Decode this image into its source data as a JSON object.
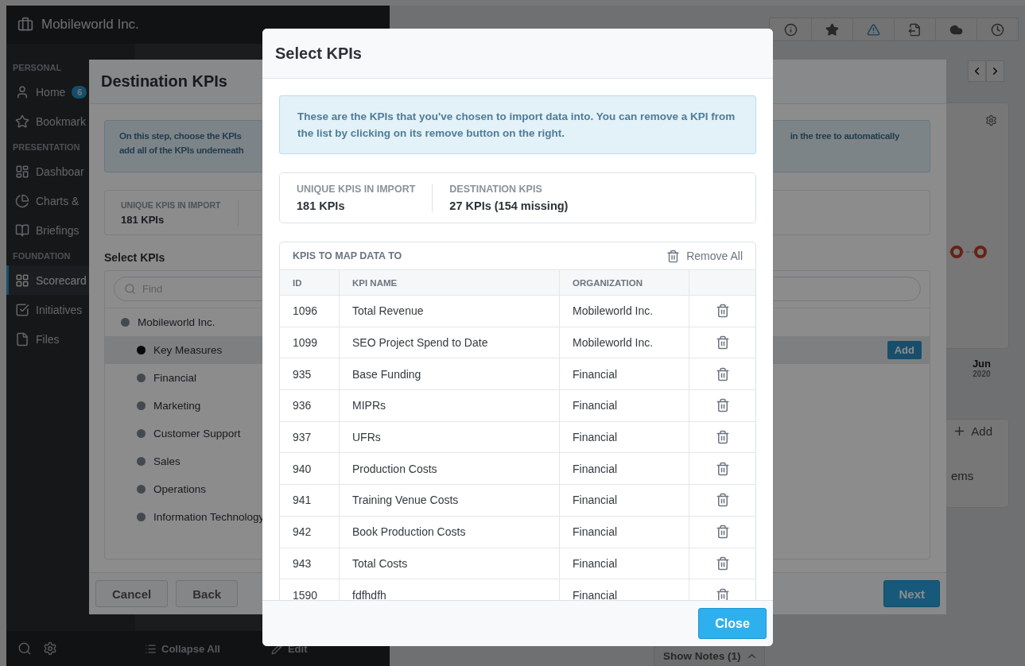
{
  "sidebar": {
    "title": "Mobileworld Inc.",
    "sections": [
      {
        "label": "PERSONAL",
        "items": [
          {
            "label": "Home",
            "badge": "6",
            "selected": false
          },
          {
            "label": "Bookmark",
            "selected": false
          }
        ]
      },
      {
        "label": "PRESENTATION",
        "items": [
          {
            "label": "Dashboar",
            "selected": false
          },
          {
            "label": "Charts &",
            "selected": false
          },
          {
            "label": "Briefings",
            "selected": false
          }
        ]
      },
      {
        "label": "FOUNDATION",
        "items": [
          {
            "label": "Scorecard",
            "selected": true
          },
          {
            "label": "Initiatives",
            "selected": false
          },
          {
            "label": "Files",
            "selected": false
          }
        ]
      }
    ]
  },
  "tree_toolbar": {
    "collapse": "Collapse All",
    "edit": "Edit"
  },
  "main": {
    "chart_month": "Jun",
    "chart_year": "2020",
    "panel_add": "Add",
    "panel_text": "ems",
    "notes": "Show Notes (1)"
  },
  "destination_dialog": {
    "title": "Destination KPIs",
    "info_lines": [
      "On this step, choose the KPIs",
      "add all of the KPIs underneath"
    ],
    "info_right": "in the tree to automatically",
    "stats": [
      {
        "label": "UNIQUE KPIS IN IMPORT",
        "value": "181 KPIs"
      }
    ],
    "tree_title": "Select KPIs",
    "search_placeholder": "Find",
    "tree": [
      {
        "label": "Mobileworld Inc.",
        "selected": false,
        "children": [
          {
            "label": "Key Measures",
            "selected": true,
            "action": "Add"
          },
          {
            "label": "Financial",
            "selected": false
          },
          {
            "label": "Marketing",
            "selected": false
          },
          {
            "label": "Customer Support",
            "selected": false
          },
          {
            "label": "Sales",
            "selected": false
          },
          {
            "label": "Operations",
            "selected": false
          },
          {
            "label": "Information Technology",
            "selected": false
          }
        ]
      }
    ],
    "buttons": {
      "cancel": "Cancel",
      "back": "Back",
      "next": "Next"
    }
  },
  "select_dialog": {
    "title": "Select KPIs",
    "info": "These are the KPIs that you've chosen to import data into. You can remove a KPI from the list by clicking on its remove button on the right.",
    "stats": [
      {
        "label": "UNIQUE KPIS IN IMPORT",
        "value": "181 KPIs"
      },
      {
        "label": "DESTINATION KPIS",
        "value": "27 KPIs (154 missing)"
      }
    ],
    "table": {
      "title": "KPIS TO MAP DATA TO",
      "remove_all": "Remove All",
      "columns": [
        "ID",
        "KPI NAME",
        "ORGANIZATION"
      ],
      "rows": [
        {
          "id": "1096",
          "name": "Total Revenue",
          "organization": "Mobileworld Inc."
        },
        {
          "id": "1099",
          "name": "SEO Project Spend to Date",
          "organization": "Mobileworld Inc."
        },
        {
          "id": "935",
          "name": "Base Funding",
          "organization": "Financial"
        },
        {
          "id": "936",
          "name": "MIPRs",
          "organization": "Financial"
        },
        {
          "id": "937",
          "name": "UFRs",
          "organization": "Financial"
        },
        {
          "id": "940",
          "name": "Production Costs",
          "organization": "Financial"
        },
        {
          "id": "941",
          "name": "Training Venue Costs",
          "organization": "Financial"
        },
        {
          "id": "942",
          "name": "Book Production Costs",
          "organization": "Financial"
        },
        {
          "id": "943",
          "name": "Total Costs",
          "organization": "Financial"
        },
        {
          "id": "1590",
          "name": "fdfhdfh",
          "organization": "Financial"
        }
      ]
    },
    "close": "Close"
  }
}
